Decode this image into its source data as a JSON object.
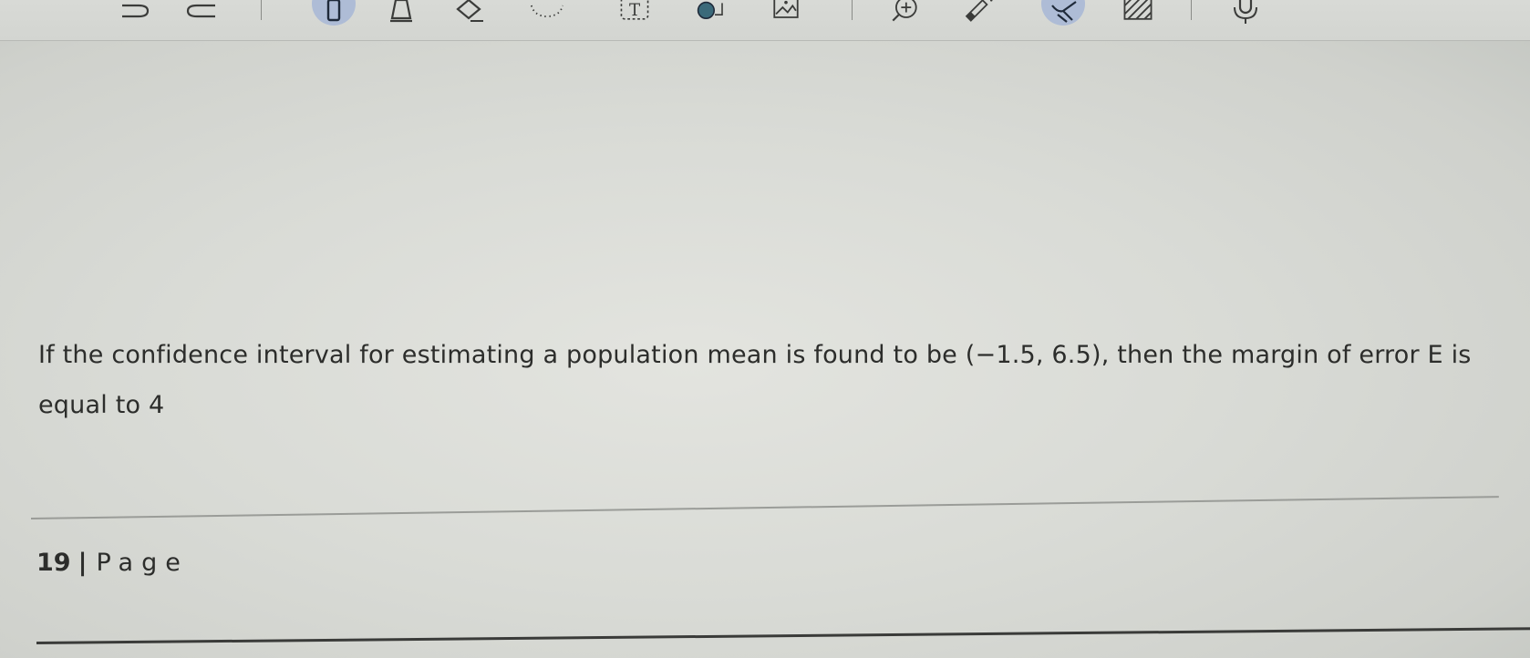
{
  "toolbar": {
    "tools": [
      {
        "icon": "undo-icon",
        "active": false
      },
      {
        "icon": "redo-icon",
        "active": false
      },
      {
        "icon": "pen-icon",
        "active": true
      },
      {
        "icon": "highlighter-icon",
        "active": false
      },
      {
        "icon": "eraser-icon",
        "active": false
      },
      {
        "icon": "lasso-select-icon",
        "active": false
      },
      {
        "icon": "text-box-icon",
        "active": false
      },
      {
        "icon": "shapes-icon",
        "active": false
      },
      {
        "icon": "insert-image-icon",
        "active": false
      },
      {
        "icon": "zoom-in-icon",
        "active": false
      },
      {
        "icon": "laser-pointer-icon",
        "active": false
      },
      {
        "icon": "hand-pan-icon",
        "active": true
      },
      {
        "icon": "fill-pattern-icon",
        "active": false
      },
      {
        "icon": "microphone-icon",
        "active": false
      }
    ],
    "text_tool_glyph": "T",
    "colors": {
      "active_highlight": "#aebcd6",
      "icon_stroke": "#3b3c3a",
      "shape_fill": "#3b6a7a"
    }
  },
  "document": {
    "question": "If the confidence interval for estimating a population mean is found to be (−1.5, 6.5), then the margin of error E is equal to 4",
    "page_number": "19",
    "page_separator": "|",
    "page_word": "Page"
  }
}
